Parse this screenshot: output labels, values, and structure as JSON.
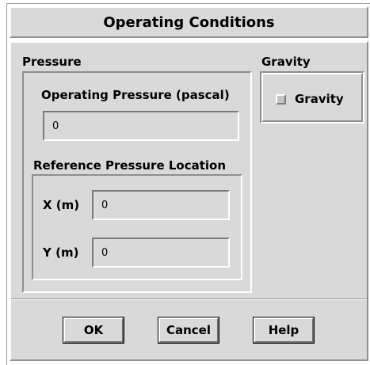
{
  "dialog": {
    "title": "Operating Conditions"
  },
  "pressure": {
    "section_label": "Pressure",
    "operating_pressure_label": "Operating Pressure (pascal)",
    "operating_pressure_value": "0",
    "reference_location_label": "Reference Pressure Location",
    "x_label": "X (m)",
    "x_value": "0",
    "y_label": "Y (m)",
    "y_value": "0"
  },
  "gravity": {
    "section_label": "Gravity",
    "checkbox_label": "Gravity",
    "checked": false
  },
  "buttons": {
    "ok": "OK",
    "cancel": "Cancel",
    "help": "Help"
  }
}
